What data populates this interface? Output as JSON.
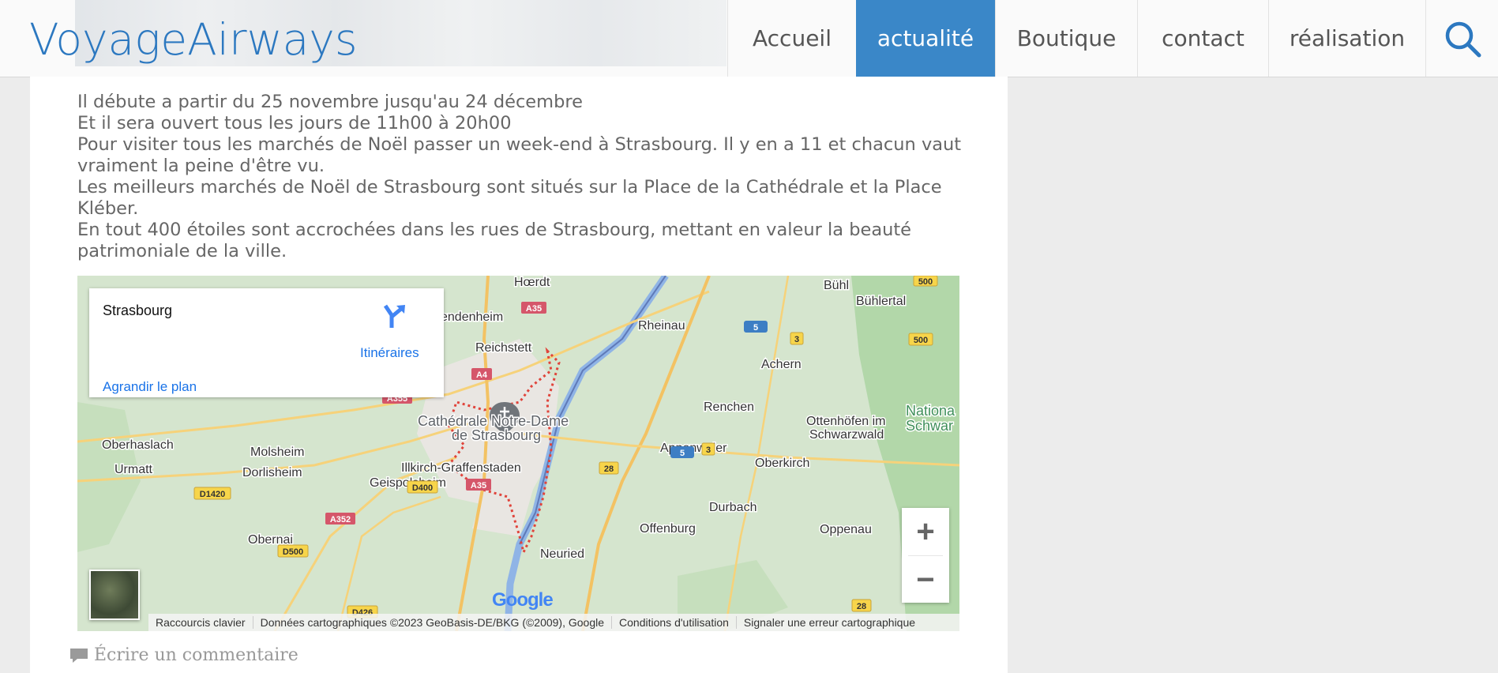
{
  "header": {
    "logo": "VoyageAirways",
    "nav": [
      "Accueil",
      "actualité",
      "Boutique",
      "contact",
      "réalisation"
    ],
    "active_nav": "actualité"
  },
  "article": {
    "lines": [
      "Il débute a partir du 25 novembre jusqu'au 24 décembre",
      "Et il sera ouvert tous les jours de 11h00 à 20h00",
      "Pour visiter tous les marchés de Noël passer un week-end à Strasbourg. Il y en a 11 et chacun vaut vraiment la peine d'être vu.",
      "Les meilleurs marchés de Noël de Strasbourg sont situés sur la Place de la Cathédrale et la Place Kléber.",
      "En tout 400 étoiles sont accrochées dans les rues de Strasbourg, mettant en valeur la beauté patrimoniale de la ville."
    ]
  },
  "map": {
    "place_name": "Strasbourg",
    "directions_label": "Itinéraires",
    "enlarge_label": "Agrandir le plan",
    "zoom_in": "+",
    "zoom_out": "−",
    "google_logo": "Google",
    "attribution": [
      "Raccourcis clavier",
      "Données cartographiques ©2023 GeoBasis-DE/BKG (©2009), Google",
      "Conditions d'utilisation",
      "Signaler une erreur cartographique"
    ],
    "labels": {
      "hoerdt": "Hœrdt",
      "vendenheim": "endenheim",
      "reichstett": "Reichstett",
      "rheinau": "Rheinau",
      "buehl": "Bühl",
      "buehlertal": "Bühlertal",
      "achern": "Achern",
      "renchen": "Renchen",
      "cathedral1": "Cathédrale Notre-Dame",
      "cathedral2": "de Strasbourg",
      "ottenhoefen1": "Ottenhöfen im",
      "ottenhoefen2": "Schwarzwald",
      "national1": "Nationa",
      "national2": "Schwar",
      "oberhaslach": "Oberhaslach",
      "molsheim": "Molsheim",
      "appenweier": "Appenweier",
      "oberkirch": "Oberkirch",
      "urmatt": "Urmatt",
      "dorlisheim": "Dorlisheim",
      "illkirch": "Illkirch-Graffenstaden",
      "geispolsheim": "Geispolsheim",
      "durbach": "Durbach",
      "offenburg": "Offenburg",
      "oppenau": "Oppenau",
      "obernai": "Obernai",
      "neuried": "Neuried"
    },
    "roads": {
      "a35_top": "A35",
      "a4": "A4",
      "a355": "A355",
      "a35_mid": "A35",
      "a352": "A352",
      "d1420": "D1420",
      "d400": "D400",
      "d500": "D500",
      "d426": "D426",
      "r5_top": "5",
      "r3_top": "3",
      "r500_top": "500",
      "r500_right": "500",
      "r5_mid": "5",
      "r3_mid": "3",
      "r28_mid": "28",
      "r28_bot": "28"
    }
  },
  "footer": {
    "comment_label": "Écrire un commentaire"
  },
  "colors": {
    "brand": "#2c78c0",
    "active_nav": "#3a87c8",
    "link": "#1a73e8"
  }
}
